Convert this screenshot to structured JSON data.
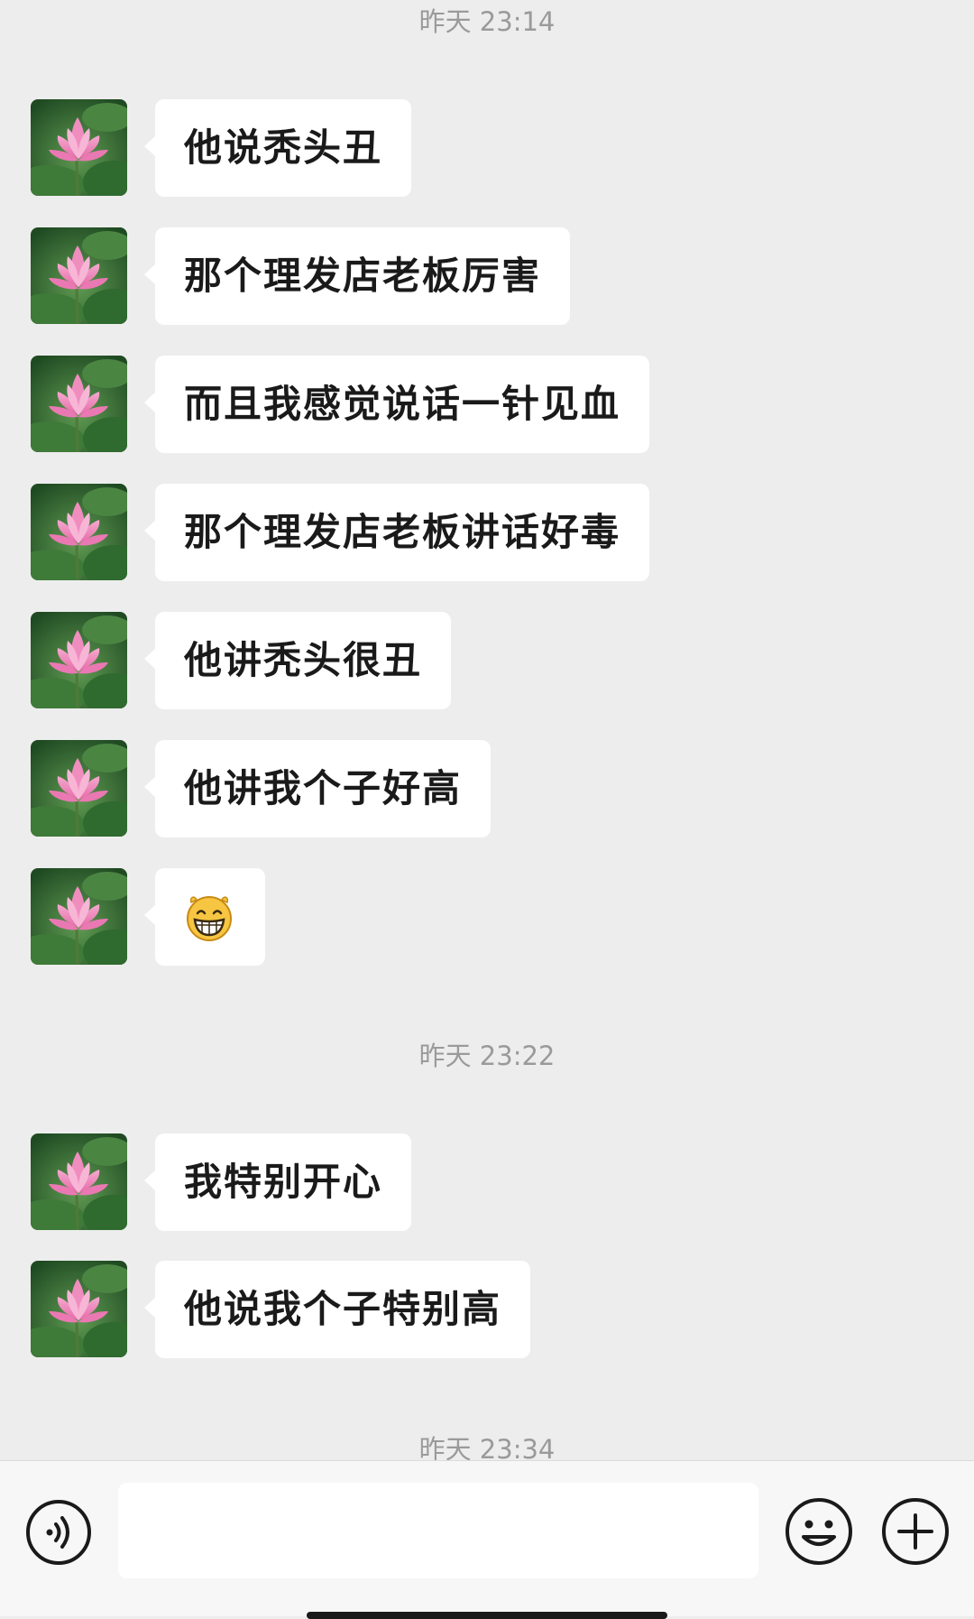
{
  "chat": {
    "timestamps": [
      "昨天 23:14",
      "昨天 23:22",
      "昨天 23:34"
    ],
    "messages": [
      {
        "type": "text",
        "text": "他说秃头丑"
      },
      {
        "type": "text",
        "text": "那个理发店老板厉害"
      },
      {
        "type": "text",
        "text": "而且我感觉说话一针见血"
      },
      {
        "type": "text",
        "text": "那个理发店老板讲话好毒"
      },
      {
        "type": "text",
        "text": "他讲秃头很丑"
      },
      {
        "type": "text",
        "text": "他讲我个子好高"
      },
      {
        "type": "emoji",
        "emoji": "grinning-face-emoji"
      },
      {
        "type": "text",
        "text": "我特别开心"
      },
      {
        "type": "text",
        "text": "他说我个子特别高"
      }
    ],
    "avatar_icon": "lotus-flower-avatar"
  },
  "bottom_bar": {
    "voice_icon": "voice-input-icon",
    "message_input_value": "",
    "emoji_icon": "emoji-icon",
    "plus_icon": "plus-icon"
  },
  "colors": {
    "background": "#ededed",
    "bubble": "#ffffff",
    "timestamp_text": "#9a9a9a",
    "message_text": "#1a1a1a"
  }
}
